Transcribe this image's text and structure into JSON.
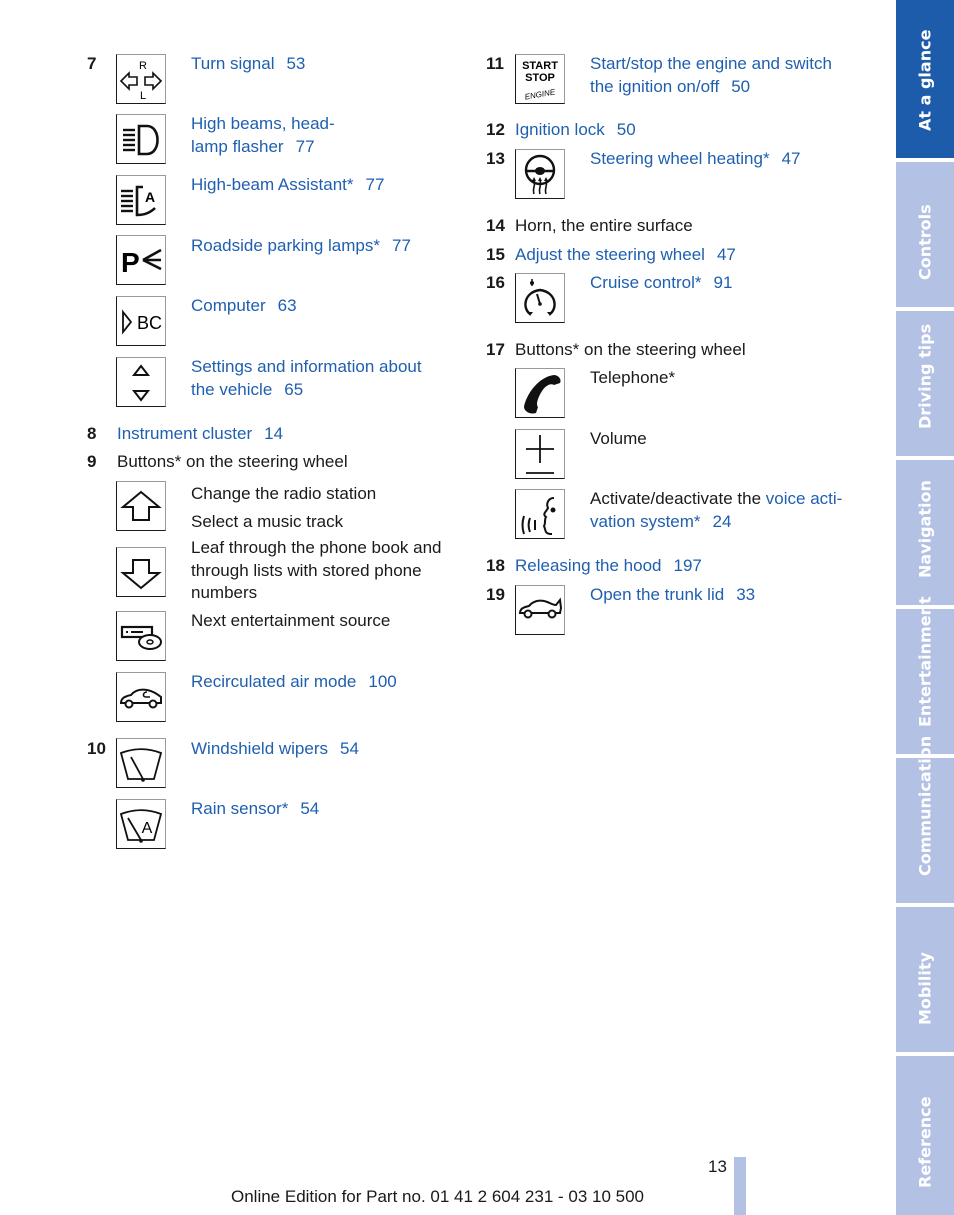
{
  "left_column": {
    "item7": {
      "number": "7",
      "entries": [
        {
          "icon": "turn-signal-icon",
          "text": "Turn signal",
          "page": "53"
        },
        {
          "icon": "high-beam-icon",
          "text_line1": "High beams, head-",
          "text_line2": "lamp flasher",
          "page": "77"
        },
        {
          "icon": "high-beam-assistant-icon",
          "text": "High-beam Assistant*",
          "page": "77"
        },
        {
          "icon": "parking-lamps-icon",
          "text": "Roadside parking lamps*",
          "page": "77"
        },
        {
          "icon": "computer-bc-icon",
          "text": "Computer",
          "page": "63"
        },
        {
          "icon": "settings-arrows-icon",
          "text_line1": "Settings and information about",
          "text_line2": "the vehicle",
          "page": "65"
        }
      ]
    },
    "item8": {
      "number": "8",
      "text": "Instrument cluster",
      "page": "14"
    },
    "item9": {
      "number": "9",
      "text": "Buttons* on the steering wheel",
      "entries": [
        {
          "icon": "arrow-up-icon",
          "text_line1": "Change the radio station",
          "text_line2": "Select a music track"
        },
        {
          "icon": "arrow-down-icon",
          "text_line1": "Leaf through the phone book and",
          "text_line2": "through lists with stored phone",
          "text_line3": "numbers"
        },
        {
          "icon": "entertainment-source-icon",
          "text": "Next entertainment source"
        },
        {
          "icon": "recirculated-air-icon",
          "text": "Recirculated air mode",
          "page": "100"
        }
      ]
    },
    "item10": {
      "number": "10",
      "entries": [
        {
          "icon": "windshield-wiper-icon",
          "text": "Windshield wipers",
          "page": "54"
        },
        {
          "icon": "rain-sensor-icon",
          "text": "Rain sensor*",
          "page": "54"
        }
      ]
    }
  },
  "right_column": {
    "item11": {
      "number": "11",
      "icon": "start-stop-icon",
      "icon_text": [
        "START",
        "STOP",
        "ENGINE"
      ],
      "text_line1": "Start/stop the engine and switch",
      "text_line2": "the ignition on/off",
      "page": "50"
    },
    "item12": {
      "number": "12",
      "text": "Ignition lock",
      "page": "50"
    },
    "item13": {
      "number": "13",
      "icon": "steering-wheel-heating-icon",
      "text": "Steering wheel heating*",
      "page": "47"
    },
    "item14": {
      "number": "14",
      "text": "Horn, the entire surface"
    },
    "item15": {
      "number": "15",
      "text": "Adjust the steering wheel",
      "page": "47"
    },
    "item16": {
      "number": "16",
      "icon": "cruise-control-icon",
      "text": "Cruise control*",
      "page": "91"
    },
    "item17": {
      "number": "17",
      "text": "Buttons* on the steering wheel",
      "entries": [
        {
          "icon": "telephone-icon",
          "text": "Telephone*"
        },
        {
          "icon": "volume-plus-minus-icon",
          "text": "Volume"
        },
        {
          "icon": "voice-activation-icon",
          "text_prefix": "Activate/deactivate the",
          "link_line1": "voice acti-",
          "link_line2": "vation system*",
          "page": "24"
        }
      ]
    },
    "item18": {
      "number": "18",
      "text": "Releasing the hood",
      "page": "197"
    },
    "item19": {
      "number": "19",
      "icon": "trunk-lid-icon",
      "text": "Open the trunk lid",
      "page": "33"
    }
  },
  "side_tabs": [
    {
      "label": "At a glance",
      "active": true
    },
    {
      "label": "Controls",
      "active": false
    },
    {
      "label": "Driving tips",
      "active": false
    },
    {
      "label": "Navigation",
      "active": false
    },
    {
      "label": "Entertainment",
      "active": false
    },
    {
      "label": "Communication",
      "active": false
    },
    {
      "label": "Mobility",
      "active": false
    },
    {
      "label": "Reference",
      "active": false
    }
  ],
  "footer": {
    "page_number": "13",
    "edition_text": "Online Edition for Part no. 01 41 2 604 231 - 03 10 500"
  },
  "colors": {
    "link": "#1f5fb0",
    "tab_active": "#1d5cab",
    "tab_inactive": "#b3c2e4"
  }
}
